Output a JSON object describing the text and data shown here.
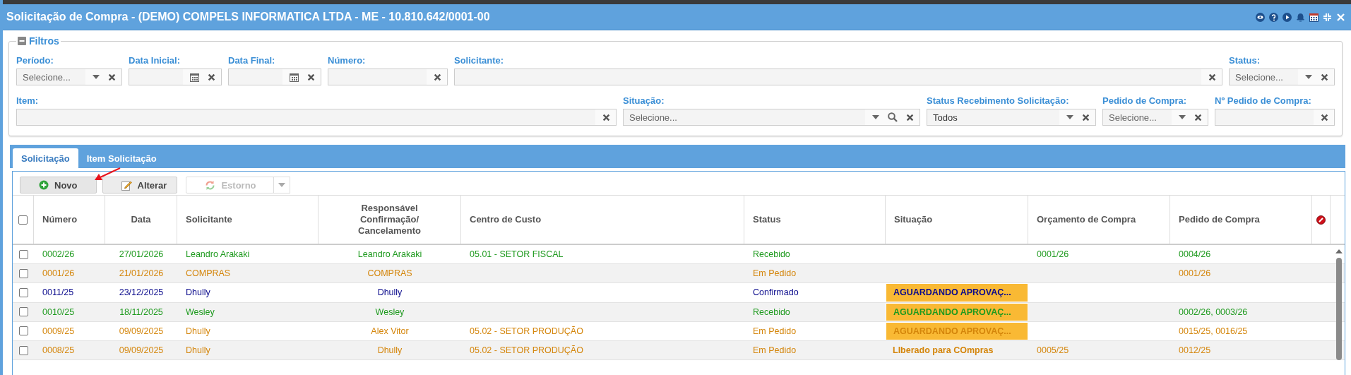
{
  "window": {
    "title": "Solicitação de Compra - (DEMO) COMPELS INFORMATICA LTDA - ME - 10.810.642/0001-00"
  },
  "filters": {
    "title": "Filtros",
    "rows": [
      {
        "fields": [
          {
            "label": "Período:",
            "kind": "select",
            "placeholder": "Selecione..."
          },
          {
            "label": "Data Inicial:",
            "kind": "date"
          },
          {
            "label": "Data Final:",
            "kind": "date"
          },
          {
            "label": "Número:",
            "kind": "text"
          },
          {
            "label": "Solicitante:",
            "kind": "text"
          },
          {
            "label": "Status:",
            "kind": "select",
            "placeholder": "Selecione..."
          }
        ]
      },
      {
        "fields": [
          {
            "label": "Item:",
            "kind": "text"
          },
          {
            "label": "Situação:",
            "kind": "lookup",
            "placeholder": "Selecione..."
          },
          {
            "label": "Status Recebimento Solicitação:",
            "kind": "select",
            "value": "Todos"
          },
          {
            "label": "Pedido de Compra:",
            "kind": "select",
            "placeholder": "Selecione..."
          },
          {
            "label": "Nº Pedido de Compra:",
            "kind": "text"
          }
        ]
      }
    ]
  },
  "tabs": [
    {
      "label": "Solicitação",
      "selected": true
    },
    {
      "label": "Item Solicitação",
      "selected": false
    }
  ],
  "toolbar": [
    {
      "label": "Novo",
      "kind": "add",
      "disabled": false
    },
    {
      "label": "Alterar",
      "kind": "edit",
      "disabled": false
    },
    {
      "label": "Estorno",
      "kind": "reverse",
      "disabled": true
    }
  ],
  "table": {
    "select_all": {
      "checked": false
    },
    "columns": [
      "Número",
      "Data",
      "Solicitante",
      "Responsável Confirmação/ Cancelamento",
      "Centro de Custo",
      "Status",
      "Situação",
      "Orçamento de Compra",
      "Pedido de Compra"
    ],
    "rows": [
      {
        "checked": false,
        "color": "#1e9a1e",
        "cells": [
          "0002/26",
          "27/01/2026",
          "Leandro Arakaki",
          "Leandro Arakaki",
          "05.01 - SETOR FISCAL",
          "Recebido",
          "",
          "0001/26",
          "0004/26"
        ],
        "situacao_highlighted": false
      },
      {
        "checked": false,
        "color": "#d4850a",
        "cells": [
          "0001/26",
          "21/01/2026",
          "COMPRAS",
          "COMPRAS",
          "",
          "Em Pedido",
          "",
          "",
          "0001/26"
        ],
        "situacao_highlighted": false
      },
      {
        "checked": false,
        "color": "#0a0a8c",
        "cells": [
          "0011/25",
          "23/12/2025",
          "Dhully",
          "Dhully",
          "",
          "Confirmado",
          "AGUARDANDO APROVAÇ...",
          "",
          ""
        ],
        "situacao_highlighted": true
      },
      {
        "checked": false,
        "color": "#1e9a1e",
        "cells": [
          "0010/25",
          "18/11/2025",
          "Wesley",
          "Wesley",
          "",
          "Recebido",
          "AGUARDANDO APROVAÇ...",
          "",
          "0002/26, 0003/26"
        ],
        "situacao_highlighted": true
      },
      {
        "checked": false,
        "color": "#d4850a",
        "cells": [
          "0009/25",
          "09/09/2025",
          "Dhully",
          "Alex Vitor",
          "05.02 - SETOR PRODUÇÃO",
          "Em Pedido",
          "AGUARDANDO APROVAÇ...",
          "",
          "0015/25, 0016/25"
        ],
        "situacao_highlighted": true
      },
      {
        "checked": false,
        "color": "#d4850a",
        "cells": [
          "0008/25",
          "09/09/2025",
          "Dhully",
          "Dhully",
          "05.02 - SETOR PRODUÇÃO",
          "Em Pedido",
          "LIberado para COmpras",
          "0005/25",
          "0012/25"
        ],
        "situacao_highlighted": false
      }
    ]
  }
}
